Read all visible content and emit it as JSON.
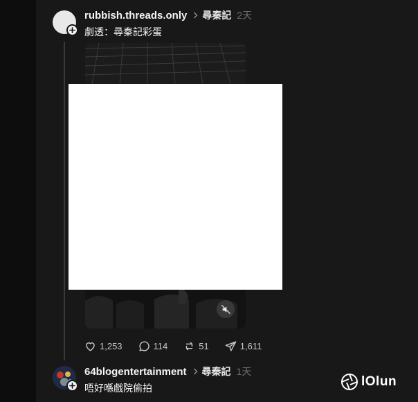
{
  "posts": [
    {
      "username": "rubbish.threads.only",
      "topic": "尋秦記",
      "time": "2天",
      "text": "劇透：尋秦記彩蛋",
      "stats": {
        "likes": "1,253",
        "replies": "114",
        "reposts": "51",
        "shares": "1,611"
      }
    },
    {
      "username": "64blogentertainment",
      "topic": "尋秦記",
      "time": "1天",
      "text": "唔好喺戲院偷拍"
    }
  ],
  "icons": {
    "like": "heart-icon",
    "reply": "comment-icon",
    "repost": "repost-icon",
    "share": "send-icon",
    "mute": "speaker-muted-icon",
    "follow": "plus-icon"
  },
  "watermark": {
    "text": "lOlun"
  },
  "colors": {
    "background": "#181818",
    "text": "#f3f5f7",
    "muted": "#6f6f6f"
  }
}
